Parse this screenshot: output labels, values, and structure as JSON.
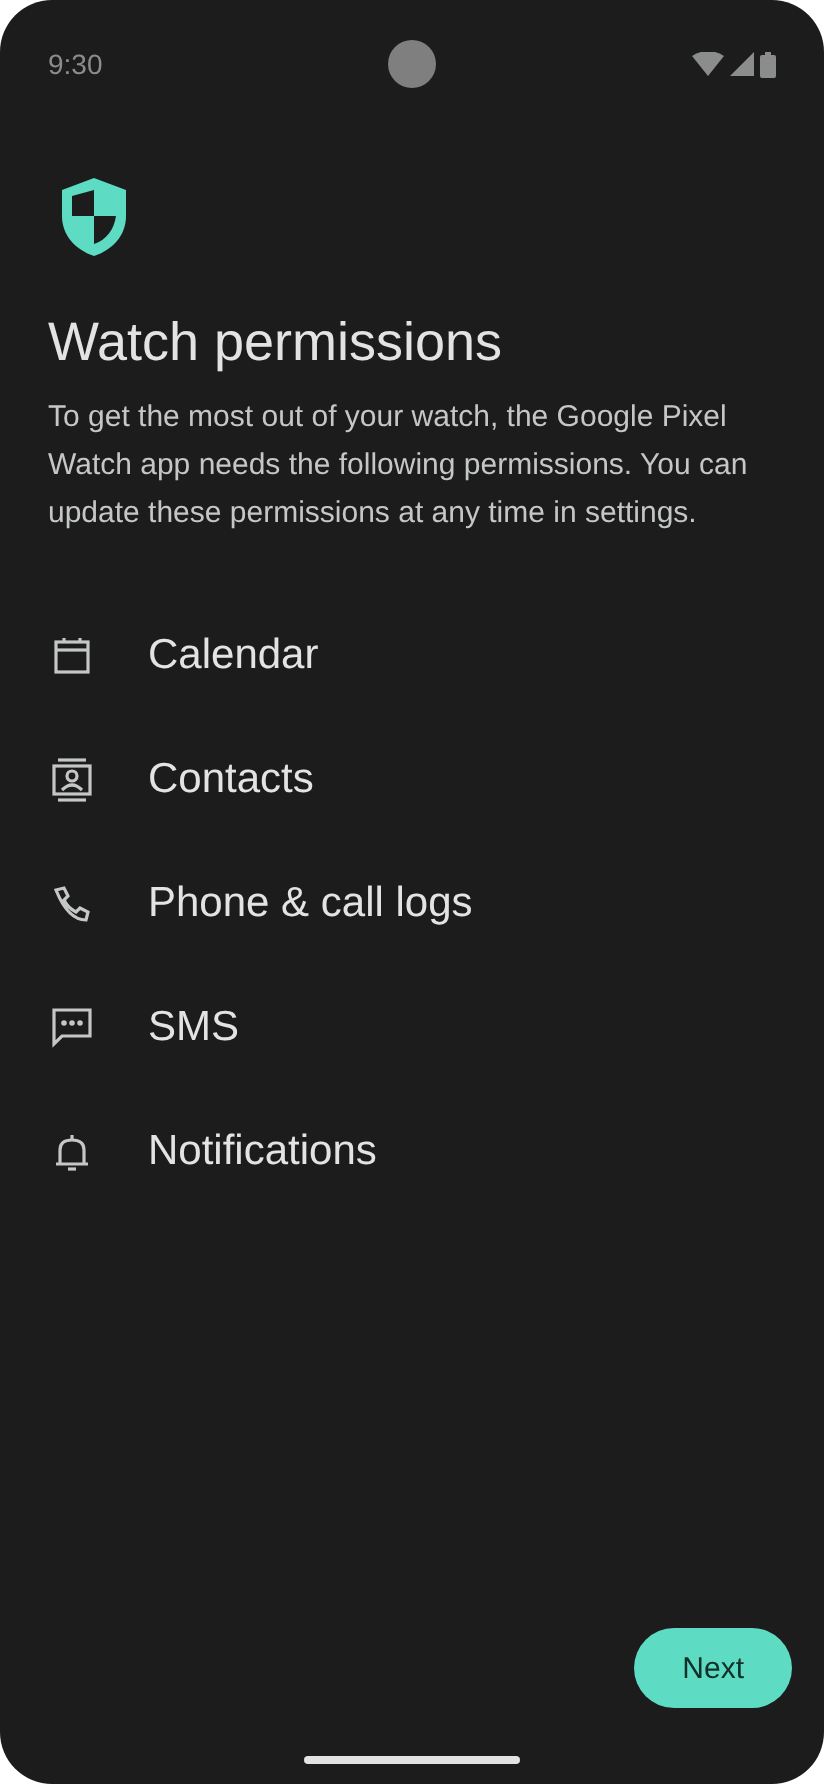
{
  "status_bar": {
    "time": "9:30"
  },
  "title": "Watch permissions",
  "description": "To get the most out of your watch, the Google Pixel Watch app needs the following permissions. You can update these permissions at any time in settings.",
  "permissions": [
    {
      "kind": "calendar",
      "label": "Calendar"
    },
    {
      "kind": "contacts",
      "label": "Contacts"
    },
    {
      "kind": "phone",
      "label": "Phone & call logs"
    },
    {
      "kind": "sms",
      "label": "SMS"
    },
    {
      "kind": "notifications",
      "label": "Notifications"
    }
  ],
  "buttons": {
    "next": "Next"
  }
}
